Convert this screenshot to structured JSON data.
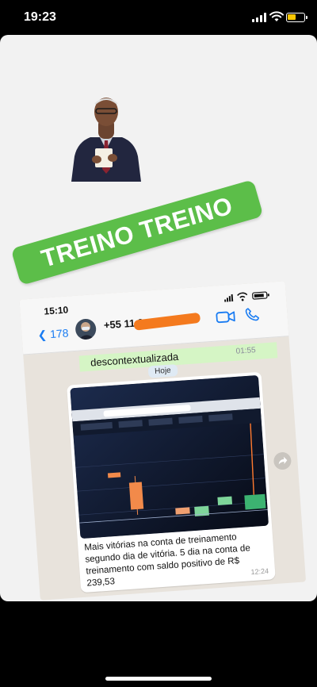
{
  "status_bar": {
    "time": "19:23"
  },
  "banner": {
    "text": "TREINO TREINO",
    "color": "#5cbe49"
  },
  "whatsapp": {
    "status_time": "15:10",
    "back_count": "178",
    "contact_number": "+55 11 9",
    "previous_message": {
      "text": "descontextualizada",
      "time": "01:55"
    },
    "date_label": "Hoje",
    "message": {
      "caption": "Mais vitórias na conta de treinamento segundo dia de vitória. 5 dia na conta de treinamento com saldo positivo de R$ 239,53",
      "time": "12:24"
    },
    "icons": [
      "back-chevron-icon",
      "video-call-icon",
      "phone-icon",
      "forward-icon"
    ],
    "accent": "#1a7cf2"
  }
}
